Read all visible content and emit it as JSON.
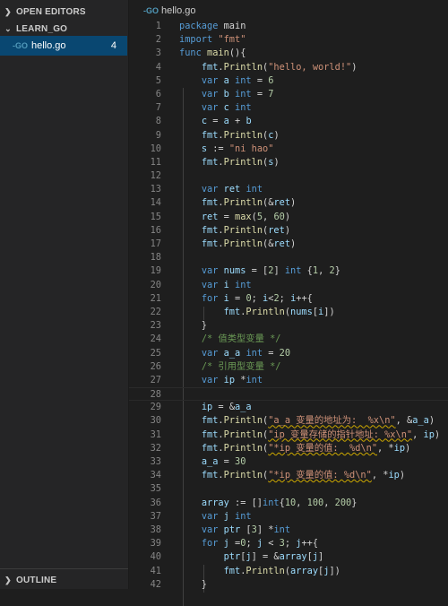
{
  "sidebar": {
    "open_editors": "OPEN EDITORS",
    "folder": "LEARN_GO",
    "file": {
      "icon": "-GO",
      "name": "hello.go",
      "count": "4"
    },
    "outline": "OUTLINE"
  },
  "tab": {
    "icon": "-GO",
    "name": "hello.go"
  },
  "code_lines": [
    [
      [
        "kw",
        "package"
      ],
      [
        "",
        ""
      ],
      [
        "",
        " main"
      ]
    ],
    [
      [
        "kw",
        "import"
      ],
      [
        "",
        " "
      ],
      [
        "str",
        "\"fmt\""
      ]
    ],
    [
      [
        "kw",
        "func"
      ],
      [
        "",
        " "
      ],
      [
        "fn",
        "main"
      ],
      [
        "",
        "(){"
      ]
    ],
    [
      [
        "",
        "    "
      ],
      [
        "var",
        "fmt"
      ],
      [
        "",
        "."
      ],
      [
        "fn",
        "Println"
      ],
      [
        "",
        "("
      ],
      [
        "str",
        "\"hello, world!\""
      ],
      [
        "",
        ")"
      ]
    ],
    [
      [
        "",
        "    "
      ],
      [
        "kw",
        "var"
      ],
      [
        "",
        " "
      ],
      [
        "var",
        "a"
      ],
      [
        "",
        " "
      ],
      [
        "kw",
        "int"
      ],
      [
        "",
        " = "
      ],
      [
        "num",
        "6"
      ]
    ],
    [
      [
        "",
        "    "
      ],
      [
        "kw",
        "var"
      ],
      [
        "",
        " "
      ],
      [
        "var",
        "b"
      ],
      [
        "",
        " "
      ],
      [
        "kw",
        "int"
      ],
      [
        "",
        " = "
      ],
      [
        "num",
        "7"
      ]
    ],
    [
      [
        "",
        "    "
      ],
      [
        "kw",
        "var"
      ],
      [
        "",
        " "
      ],
      [
        "var",
        "c"
      ],
      [
        "",
        " "
      ],
      [
        "kw",
        "int"
      ]
    ],
    [
      [
        "",
        "    "
      ],
      [
        "var",
        "c"
      ],
      [
        "",
        " = "
      ],
      [
        "var",
        "a"
      ],
      [
        "",
        " + "
      ],
      [
        "var",
        "b"
      ]
    ],
    [
      [
        "",
        "    "
      ],
      [
        "var",
        "fmt"
      ],
      [
        "",
        "."
      ],
      [
        "fn",
        "Println"
      ],
      [
        "",
        "("
      ],
      [
        "var",
        "c"
      ],
      [
        "",
        ")"
      ]
    ],
    [
      [
        "",
        "    "
      ],
      [
        "var",
        "s"
      ],
      [
        "",
        " := "
      ],
      [
        "str",
        "\"ni hao\""
      ]
    ],
    [
      [
        "",
        "    "
      ],
      [
        "var",
        "fmt"
      ],
      [
        "",
        "."
      ],
      [
        "fn",
        "Println"
      ],
      [
        "",
        "("
      ],
      [
        "var",
        "s"
      ],
      [
        "",
        ")"
      ]
    ],
    [
      [
        "",
        ""
      ]
    ],
    [
      [
        "",
        "    "
      ],
      [
        "kw",
        "var"
      ],
      [
        "",
        " "
      ],
      [
        "var",
        "ret"
      ],
      [
        "",
        " "
      ],
      [
        "kw",
        "int"
      ]
    ],
    [
      [
        "",
        "    "
      ],
      [
        "var",
        "fmt"
      ],
      [
        "",
        "."
      ],
      [
        "fn",
        "Println"
      ],
      [
        "",
        "(&"
      ],
      [
        "var",
        "ret"
      ],
      [
        "",
        ")"
      ]
    ],
    [
      [
        "",
        "    "
      ],
      [
        "var",
        "ret"
      ],
      [
        "",
        " = "
      ],
      [
        "fn",
        "max"
      ],
      [
        "",
        "("
      ],
      [
        "num",
        "5"
      ],
      [
        "",
        ", "
      ],
      [
        "num",
        "60"
      ],
      [
        "",
        ")"
      ]
    ],
    [
      [
        "",
        "    "
      ],
      [
        "var",
        "fmt"
      ],
      [
        "",
        "."
      ],
      [
        "fn",
        "Println"
      ],
      [
        "",
        "("
      ],
      [
        "var",
        "ret"
      ],
      [
        "",
        ")"
      ]
    ],
    [
      [
        "",
        "    "
      ],
      [
        "var",
        "fmt"
      ],
      [
        "",
        "."
      ],
      [
        "fn",
        "Println"
      ],
      [
        "",
        "(&"
      ],
      [
        "var",
        "ret"
      ],
      [
        "",
        ")"
      ]
    ],
    [
      [
        "",
        ""
      ]
    ],
    [
      [
        "",
        "    "
      ],
      [
        "kw",
        "var"
      ],
      [
        "",
        " "
      ],
      [
        "var",
        "nums"
      ],
      [
        "",
        " = ["
      ],
      [
        "num",
        "2"
      ],
      [
        "",
        "] "
      ],
      [
        "kw",
        "int"
      ],
      [
        "",
        " {"
      ],
      [
        "num",
        "1"
      ],
      [
        "",
        ", "
      ],
      [
        "num",
        "2"
      ],
      [
        "",
        "}"
      ]
    ],
    [
      [
        "",
        "    "
      ],
      [
        "kw",
        "var"
      ],
      [
        "",
        " "
      ],
      [
        "var",
        "i"
      ],
      [
        "",
        " "
      ],
      [
        "kw",
        "int"
      ]
    ],
    [
      [
        "",
        "    "
      ],
      [
        "kw",
        "for"
      ],
      [
        "",
        " "
      ],
      [
        "var",
        "i"
      ],
      [
        "",
        " = "
      ],
      [
        "num",
        "0"
      ],
      [
        "",
        "; "
      ],
      [
        "var",
        "i"
      ],
      [
        "",
        "<"
      ],
      [
        "num",
        "2"
      ],
      [
        "",
        "; "
      ],
      [
        "var",
        "i"
      ],
      [
        "",
        "++{"
      ]
    ],
    [
      [
        "",
        "        "
      ],
      [
        "var",
        "fmt"
      ],
      [
        "",
        "."
      ],
      [
        "fn",
        "Println"
      ],
      [
        "",
        "("
      ],
      [
        "var",
        "nums"
      ],
      [
        "",
        "["
      ],
      [
        "var",
        "i"
      ],
      [
        "",
        "])"
      ]
    ],
    [
      [
        "",
        "    }"
      ]
    ],
    [
      [
        "",
        "    "
      ],
      [
        "cm",
        "/* 值类型变量 */"
      ]
    ],
    [
      [
        "",
        "    "
      ],
      [
        "kw",
        "var"
      ],
      [
        "",
        " "
      ],
      [
        "var",
        "a_a"
      ],
      [
        "",
        " "
      ],
      [
        "kw",
        "int"
      ],
      [
        "",
        " = "
      ],
      [
        "num",
        "20"
      ]
    ],
    [
      [
        "",
        "    "
      ],
      [
        "cm",
        "/* 引用型变量 */"
      ]
    ],
    [
      [
        "",
        "    "
      ],
      [
        "kw",
        "var"
      ],
      [
        "",
        " "
      ],
      [
        "var",
        "ip"
      ],
      [
        "",
        " *"
      ],
      [
        "kw",
        "int"
      ]
    ],
    [
      [
        "",
        ""
      ]
    ],
    [
      [
        "",
        "    "
      ],
      [
        "var",
        "ip"
      ],
      [
        "",
        " = &"
      ],
      [
        "var",
        "a_a"
      ]
    ],
    [
      [
        "",
        "    "
      ],
      [
        "var",
        "fmt"
      ],
      [
        "",
        "."
      ],
      [
        "fn",
        "Println"
      ],
      [
        "",
        "("
      ],
      [
        "str sq",
        "\"a_a 变量的地址为:  %x\\n\""
      ],
      [
        "",
        ", &"
      ],
      [
        "var",
        "a_a"
      ],
      [
        "",
        ")"
      ]
    ],
    [
      [
        "",
        "    "
      ],
      [
        "var",
        "fmt"
      ],
      [
        "",
        "."
      ],
      [
        "fn",
        "Println"
      ],
      [
        "",
        "("
      ],
      [
        "str sq",
        "\"ip 变量存储的指针地址: %x\\n\""
      ],
      [
        "",
        ", "
      ],
      [
        "var",
        "ip"
      ],
      [
        "",
        ")"
      ]
    ],
    [
      [
        "",
        "    "
      ],
      [
        "var",
        "fmt"
      ],
      [
        "",
        "."
      ],
      [
        "fn",
        "Println"
      ],
      [
        "",
        "("
      ],
      [
        "str sq",
        "\"*ip 变量的值:  %d\\n\""
      ],
      [
        "",
        ", *"
      ],
      [
        "var",
        "ip"
      ],
      [
        "",
        ")"
      ]
    ],
    [
      [
        "",
        "    "
      ],
      [
        "var",
        "a_a"
      ],
      [
        "",
        " = "
      ],
      [
        "num",
        "30"
      ]
    ],
    [
      [
        "",
        "    "
      ],
      [
        "var",
        "fmt"
      ],
      [
        "",
        "."
      ],
      [
        "fn",
        "Println"
      ],
      [
        "",
        "("
      ],
      [
        "str sq",
        "\"*ip 变量的值: %d\\n\""
      ],
      [
        "",
        ", *"
      ],
      [
        "var",
        "ip"
      ],
      [
        "",
        ")"
      ]
    ],
    [
      [
        "",
        ""
      ]
    ],
    [
      [
        "",
        "    "
      ],
      [
        "var",
        "array"
      ],
      [
        "",
        " := []"
      ],
      [
        "kw",
        "int"
      ],
      [
        "",
        "{"
      ],
      [
        "num",
        "10"
      ],
      [
        "",
        ", "
      ],
      [
        "num",
        "100"
      ],
      [
        "",
        ", "
      ],
      [
        "num",
        "200"
      ],
      [
        "",
        "}"
      ]
    ],
    [
      [
        "",
        "    "
      ],
      [
        "kw",
        "var"
      ],
      [
        "",
        " "
      ],
      [
        "var",
        "j"
      ],
      [
        "",
        " "
      ],
      [
        "kw",
        "int"
      ]
    ],
    [
      [
        "",
        "    "
      ],
      [
        "kw",
        "var"
      ],
      [
        "",
        " "
      ],
      [
        "var",
        "ptr"
      ],
      [
        "",
        " ["
      ],
      [
        "num",
        "3"
      ],
      [
        "",
        "] *"
      ],
      [
        "kw",
        "int"
      ]
    ],
    [
      [
        "",
        "    "
      ],
      [
        "kw",
        "for"
      ],
      [
        "",
        " "
      ],
      [
        "var",
        "j"
      ],
      [
        "",
        " ="
      ],
      [
        "num",
        "0"
      ],
      [
        "",
        "; "
      ],
      [
        "var",
        "j"
      ],
      [
        "",
        " < "
      ],
      [
        "num",
        "3"
      ],
      [
        "",
        "; "
      ],
      [
        "var",
        "j"
      ],
      [
        "",
        "++{"
      ]
    ],
    [
      [
        "",
        "        "
      ],
      [
        "var",
        "ptr"
      ],
      [
        "",
        "["
      ],
      [
        "var",
        "j"
      ],
      [
        "",
        "] = &"
      ],
      [
        "var",
        "array"
      ],
      [
        "",
        "["
      ],
      [
        "var",
        "j"
      ],
      [
        "",
        "]"
      ]
    ],
    [
      [
        "",
        "        "
      ],
      [
        "var",
        "fmt"
      ],
      [
        "",
        "."
      ],
      [
        "fn",
        "Println"
      ],
      [
        "",
        "("
      ],
      [
        "var",
        "array"
      ],
      [
        "",
        "["
      ],
      [
        "var",
        "j"
      ],
      [
        "",
        "])"
      ]
    ],
    [
      [
        "",
        "    }"
      ]
    ]
  ]
}
